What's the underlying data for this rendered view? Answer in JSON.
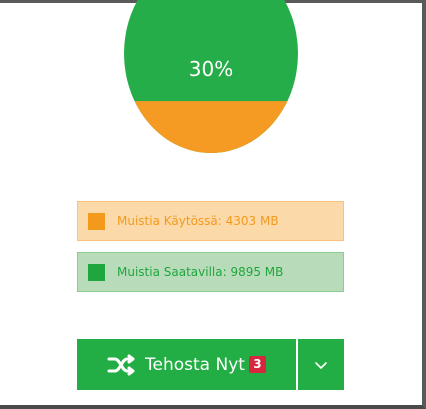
{
  "gauge": {
    "label": "30%",
    "used_fraction": 0.3,
    "colors": {
      "available": "#25ad4a",
      "used": "#f59a22"
    }
  },
  "legend": {
    "used_label": "Muistia Käytössä: 4303 MB",
    "available_label": "Muistia Saatavilla: 9895 MB"
  },
  "actions": {
    "boost_label": "Tehosta Nyt",
    "boost_badge": "3",
    "boost_icon": "shuffle-icon",
    "dropdown_icon": "chevron-down-icon"
  }
}
